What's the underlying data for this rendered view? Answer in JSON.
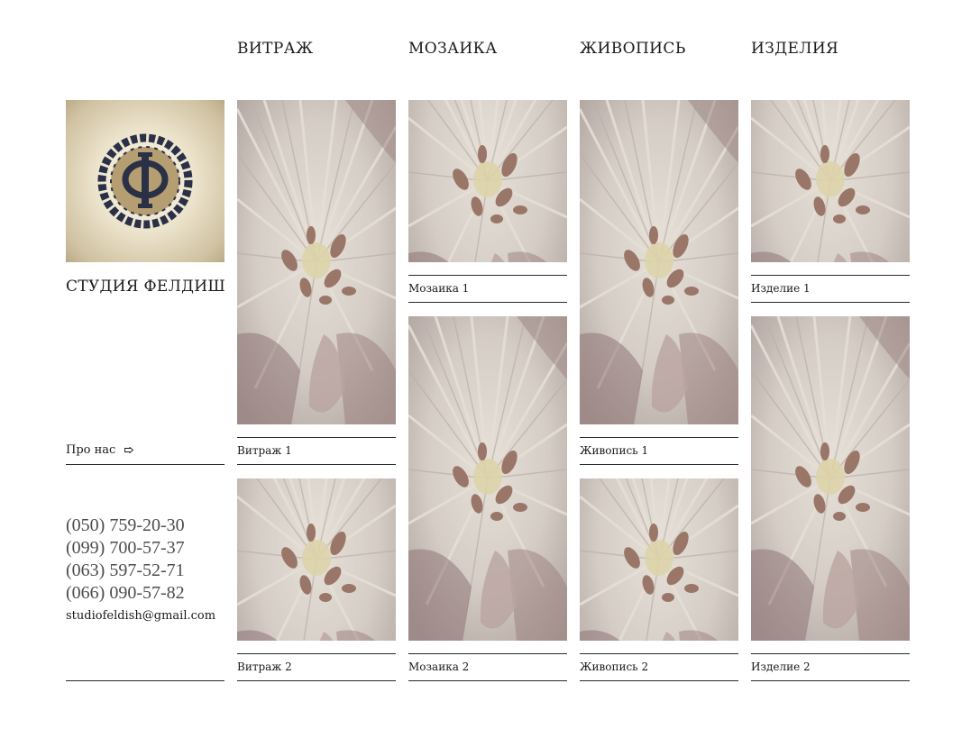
{
  "nav": {
    "vitrazh": "ВИТРАЖ",
    "mozaika": "МОЗАИКА",
    "zhivopis": "ЖИВОПИСЬ",
    "izdeliya": "ИЗДЕЛИЯ"
  },
  "studio": {
    "title": "СТУДИЯ ФЕЛДИШ",
    "about_label": "Про нас"
  },
  "contacts": {
    "phones": [
      "(050) 759-20-30",
      "(099) 700-57-37",
      "(063) 597-52-71",
      "(066) 090-57-82"
    ],
    "email": "studiofeldish@gmail.com"
  },
  "gallery": {
    "vitrazh": [
      "Витраж 1",
      "Витраж 2"
    ],
    "mozaika": [
      "Мозаика 1",
      "Мозаика 2"
    ],
    "zhivopis": [
      "Живопись 1",
      "Живопись 2"
    ],
    "izdeliya": [
      "Изделие 1",
      "Изделие 2"
    ]
  },
  "colors": {
    "logo_dark": "#2a3045",
    "logo_tan": "#b59e72",
    "photo_overlay": "#c8c0ba"
  }
}
